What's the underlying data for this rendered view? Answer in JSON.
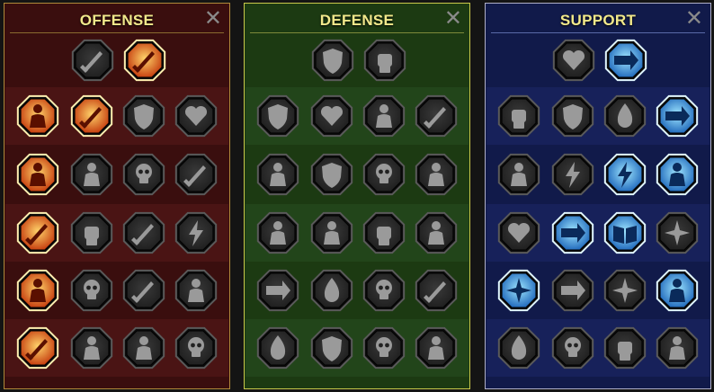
{
  "panels": [
    {
      "id": "offense",
      "title": "OFFENSE",
      "close": "✕",
      "colors": {
        "border": "#b08a3a",
        "bg": "#3a0e0e",
        "band_a": "#4a1414",
        "band_b": "#3a0e0e",
        "rule": "#8a6a30"
      },
      "top": [
        {
          "icon": "crossed-swords-icon",
          "state": "inactive"
        },
        {
          "icon": "sword-strike-icon",
          "state": "active"
        }
      ],
      "rows": [
        [
          {
            "icon": "demon-rage-icon",
            "state": "active"
          },
          {
            "icon": "blade-slash-icon",
            "state": "active"
          },
          {
            "icon": "shield-break-icon",
            "state": "inactive"
          },
          {
            "icon": "broken-heart-icon",
            "state": "inactive"
          }
        ],
        [
          {
            "icon": "bleeding-figure-icon",
            "state": "active"
          },
          {
            "icon": "monster-jaw-icon",
            "state": "inactive"
          },
          {
            "icon": "skull-bone-icon",
            "state": "inactive"
          },
          {
            "icon": "scythe-hand-icon",
            "state": "inactive"
          }
        ],
        [
          {
            "icon": "dagger-pierce-icon",
            "state": "active"
          },
          {
            "icon": "gauntlet-icon",
            "state": "inactive"
          },
          {
            "icon": "axe-strike-icon",
            "state": "inactive"
          },
          {
            "icon": "chain-lightning-icon",
            "state": "inactive"
          }
        ],
        [
          {
            "icon": "shattered-figure-icon",
            "state": "active"
          },
          {
            "icon": "skull-cloud-icon",
            "state": "inactive"
          },
          {
            "icon": "blade-aura-icon",
            "state": "inactive"
          },
          {
            "icon": "warrior-fury-icon",
            "state": "inactive"
          }
        ],
        [
          {
            "icon": "sparkle-sword-icon",
            "state": "active"
          },
          {
            "icon": "knight-helm-icon",
            "state": "inactive"
          },
          {
            "icon": "horned-demon-icon",
            "state": "inactive"
          },
          {
            "icon": "skull-helm-icon",
            "state": "inactive"
          }
        ]
      ]
    },
    {
      "id": "defense",
      "title": "DEFENSE",
      "close": "✕",
      "colors": {
        "border": "#c9c94a",
        "bg": "#1c3a12",
        "band_a": "#22451a",
        "band_b": "#1c3a12",
        "rule": "#7e8a3a"
      },
      "top": [
        {
          "icon": "brick-wall-icon",
          "state": "inactive"
        },
        {
          "icon": "raised-fist-icon",
          "state": "inactive"
        }
      ],
      "rows": [
        [
          {
            "icon": "chevron-shield-icon",
            "state": "inactive"
          },
          {
            "icon": "flame-heart-icon",
            "state": "inactive"
          },
          {
            "icon": "muscle-man-icon",
            "state": "inactive"
          },
          {
            "icon": "blade-deflect-icon",
            "state": "inactive"
          }
        ],
        [
          {
            "icon": "gatekeeper-icon",
            "state": "inactive"
          },
          {
            "icon": "shield-bearer-icon",
            "state": "inactive"
          },
          {
            "icon": "skull-heart-icon",
            "state": "inactive"
          },
          {
            "icon": "halo-head-icon",
            "state": "inactive"
          }
        ],
        [
          {
            "icon": "army-icon",
            "state": "inactive"
          },
          {
            "icon": "hourglass-icon",
            "state": "inactive"
          },
          {
            "icon": "palm-hand-icon",
            "state": "inactive"
          },
          {
            "icon": "bull-head-icon",
            "state": "inactive"
          }
        ],
        [
          {
            "icon": "dash-runner-icon",
            "state": "inactive"
          },
          {
            "icon": "drops-icon",
            "state": "inactive"
          },
          {
            "icon": "skull-sun-icon",
            "state": "inactive"
          },
          {
            "icon": "sword-curve-icon",
            "state": "inactive"
          }
        ],
        [
          {
            "icon": "flame-warrior-icon",
            "state": "inactive"
          },
          {
            "icon": "winged-shield-icon",
            "state": "inactive"
          },
          {
            "icon": "skull-chain-icon",
            "state": "inactive"
          },
          {
            "icon": "flex-figure-icon",
            "state": "inactive"
          }
        ]
      ]
    },
    {
      "id": "support",
      "title": "SUPPORT",
      "close": "✕",
      "colors": {
        "border": "#b0b0c8",
        "bg": "#111a4a",
        "band_a": "#17215a",
        "band_b": "#111a4a",
        "rule": "#5a6aa8"
      },
      "top": [
        {
          "icon": "heal-heart-icon",
          "state": "inactive"
        },
        {
          "icon": "swirl-charge-icon",
          "state": "active"
        }
      ],
      "rows": [
        [
          {
            "icon": "praying-hands-icon",
            "state": "inactive"
          },
          {
            "icon": "barrier-icon",
            "state": "inactive"
          },
          {
            "icon": "spirit-flame-icon",
            "state": "inactive"
          },
          {
            "icon": "speed-arrow-icon",
            "state": "active"
          }
        ],
        [
          {
            "icon": "blessing-figure-icon",
            "state": "inactive"
          },
          {
            "icon": "lightning-icon",
            "state": "inactive"
          },
          {
            "icon": "stun-crack-icon",
            "state": "active"
          },
          {
            "icon": "dual-silhouette-icon",
            "state": "active"
          }
        ],
        [
          {
            "icon": "chained-heart-icon",
            "state": "inactive"
          },
          {
            "icon": "meteor-icon",
            "state": "active"
          },
          {
            "icon": "open-book-icon",
            "state": "active"
          },
          {
            "icon": "angry-eyes-icon",
            "state": "inactive"
          }
        ],
        [
          {
            "icon": "compass-star-icon",
            "state": "active"
          },
          {
            "icon": "swift-boot-icon",
            "state": "inactive"
          },
          {
            "icon": "watching-eye-icon",
            "state": "inactive"
          },
          {
            "icon": "dodge-figure-icon",
            "state": "active"
          }
        ],
        [
          {
            "icon": "potion-icon",
            "state": "inactive"
          },
          {
            "icon": "death-skull-icon",
            "state": "inactive"
          },
          {
            "icon": "grasping-hand-icon",
            "state": "inactive"
          },
          {
            "icon": "eagle-head-icon",
            "state": "inactive"
          }
        ]
      ]
    }
  ],
  "active_palettes": {
    "offense": {
      "fill_in": "#ffd36a",
      "fill_out": "#c2350a",
      "ring": "#ffefb0",
      "glyph": "#5a0f00"
    },
    "defense": {
      "fill_in": "#d6ff8a",
      "fill_out": "#3f8a14",
      "ring": "#f0ffd0",
      "glyph": "#143a05"
    },
    "support": {
      "fill_in": "#9fe6ff",
      "fill_out": "#1a63b8",
      "ring": "#e0f6ff",
      "glyph": "#0a2a5a"
    }
  },
  "inactive_palette": {
    "fill_in": "#3a3a3a",
    "fill_out": "#1e1e1e",
    "ring": "#5a5a5a",
    "glyph": "#9a9a9a"
  }
}
